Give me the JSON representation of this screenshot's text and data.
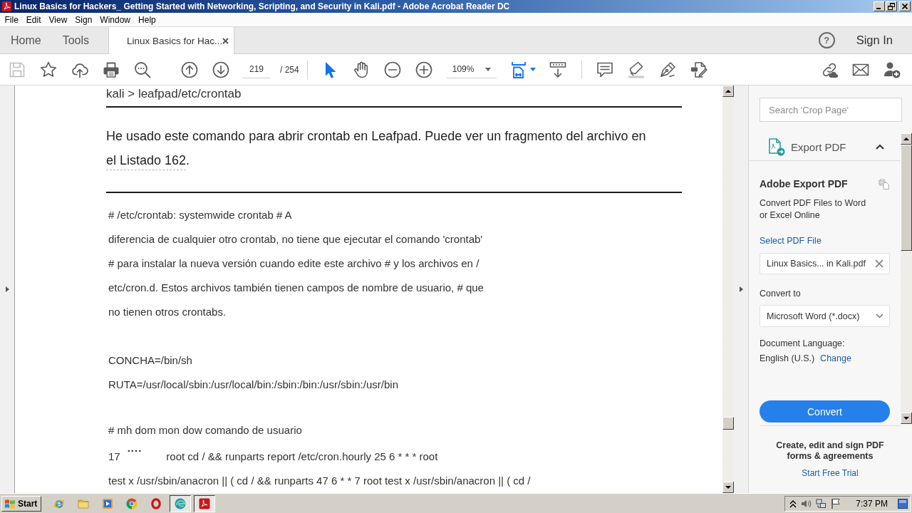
{
  "window": {
    "title": "Linux Basics for Hackers_ Getting Started with Networking, Scripting, and Security in Kali.pdf - Adobe Acrobat Reader DC"
  },
  "menu": [
    "File",
    "Edit",
    "View",
    "Sign",
    "Window",
    "Help"
  ],
  "tabs": [
    {
      "kind": "nav",
      "label": "Home",
      "selected": false
    },
    {
      "kind": "nav",
      "label": "Tools",
      "selected": false
    },
    {
      "kind": "document",
      "label": "Linux Basics for Hac...",
      "selected": true
    }
  ],
  "header": {
    "help": "?",
    "sign_in": "Sign In"
  },
  "toolbar": {
    "file_actions": [
      {
        "kind": "save",
        "disabled": true
      },
      {
        "kind": "bookmark",
        "disabled": false
      },
      {
        "kind": "upload",
        "disabled": false
      },
      {
        "kind": "print",
        "disabled": false
      },
      {
        "kind": "find",
        "disabled": false
      }
    ],
    "page_number": "219",
    "page_total": "/ 254",
    "modes": [
      {
        "kind": "select",
        "selected": true
      },
      {
        "kind": "hand",
        "selected": false
      }
    ],
    "zoom": "109%"
  },
  "document": {
    "top_line": "kali > leafpad/etc/crontab",
    "paragraph": {
      "text": "He usado este comando para abrir crontab en Leafpad. Puede ver un fragmento del archivo en",
      "link": "el Listado 162",
      "end": "."
    },
    "code_blocks": [
      [
        {
          "kind": "text",
          "text": "# /etc/crontab: systemwide crontab # A"
        },
        {
          "kind": "text",
          "text": "diferencia de cualquier otro crontab, no tiene que ejecutar el comando 'crontab'"
        },
        {
          "kind": "text",
          "text": "# para instalar la nueva versión cuando edite este archivo # y los archivos en /"
        },
        {
          "kind": "text",
          "text": "etc/cron.d. Estos archivos también tienen campos de nombre de usuario, # que"
        },
        {
          "kind": "text",
          "text": "no tienen otros crontabs."
        }
      ],
      [
        {
          "kind": "text",
          "text": "CONCHA=/bin/sh"
        },
        {
          "kind": "text",
          "text": "RUTA=/usr/local/sbin:/usr/local/bin:/sbin:/bin:/usr/sbin:/usr/bin"
        }
      ],
      [
        {
          "kind": "text",
          "text": "# mh dom mon dow comando de usuario"
        },
        {
          "kind": "fields",
          "fields": [
            "17",
            "....",
            "root cd / && runparts report /etc/cron.hourly 25 6 * * * root"
          ]
        },
        {
          "kind": "text",
          "text": "test x /usr/sbin/anacron || ( cd / && runparts 47 6 * * 7 root test x /usr/sbin/anacron || ( cd /"
        }
      ]
    ]
  },
  "right_panel": {
    "search": {
      "placeholder": "Search 'Crop Page'"
    },
    "section": {
      "title": "Export PDF",
      "expanded": true
    },
    "heading": "Adobe Export PDF",
    "description": "Convert PDF Files to Word or Excel Online",
    "file_label": "Select PDF File",
    "file": {
      "value": "Linux Basics... in Kali.pdf"
    },
    "format_label": "Convert to",
    "format": {
      "value": "Microsoft Word (*.docx)"
    },
    "language_label": "Document Language:",
    "language": "English (U.S.)",
    "language_link": "Change",
    "convert_button": "Convert",
    "promo": "Create, edit and sign PDF forms & agreements",
    "promo_link": "Start Free Trial"
  },
  "taskbar": {
    "start": "Start",
    "apps": [
      {
        "kind": "ie",
        "running": false
      },
      {
        "kind": "folder",
        "running": false
      },
      {
        "kind": "media",
        "running": false
      },
      {
        "kind": "chrome",
        "running": false
      },
      {
        "kind": "opera",
        "running": false
      },
      {
        "kind": "edge",
        "running": true
      },
      {
        "kind": "acrobat",
        "running": true
      }
    ],
    "clock": "7:37 PM"
  }
}
